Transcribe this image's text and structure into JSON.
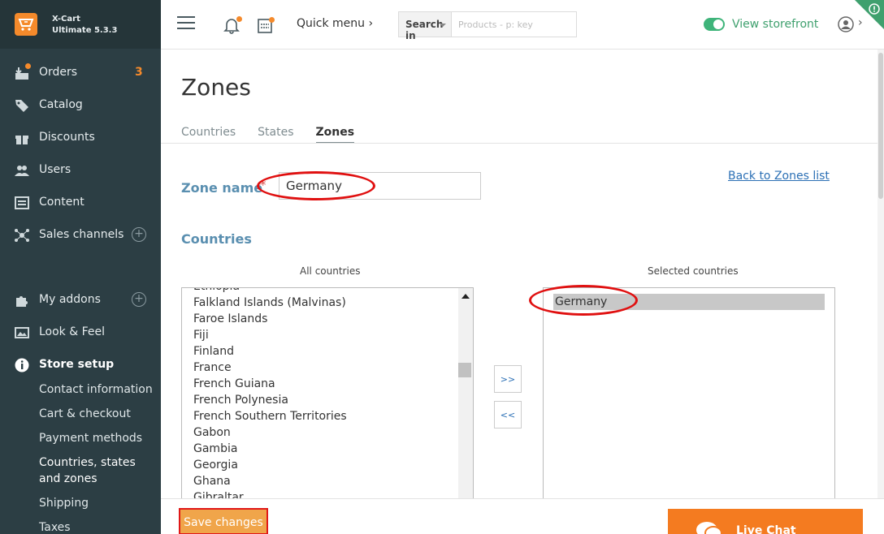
{
  "brand": {
    "name": "X-Cart",
    "edition": "Ultimate 5.3.3"
  },
  "sidebar": {
    "items": [
      {
        "label": "Orders",
        "badge": "3",
        "icon": "orders-icon"
      },
      {
        "label": "Catalog",
        "icon": "tag-icon"
      },
      {
        "label": "Discounts",
        "icon": "gift-icon"
      },
      {
        "label": "Users",
        "icon": "users-icon"
      },
      {
        "label": "Content",
        "icon": "content-icon"
      },
      {
        "label": "Sales channels",
        "icon": "share-icon"
      },
      {
        "label": "My addons",
        "icon": "puzzle-icon"
      },
      {
        "label": "Look & Feel",
        "icon": "image-icon"
      },
      {
        "label": "Store setup",
        "icon": "info-icon"
      }
    ],
    "store_setup_sub": [
      "Contact information",
      "Cart & checkout",
      "Payment methods",
      "Countries, states",
      "and zones",
      "Shipping",
      "Taxes"
    ]
  },
  "topbar": {
    "quick_menu": "Quick menu",
    "search_in": "Search in",
    "search_placeholder": "Products - p: key",
    "view_storefront": "View storefront"
  },
  "page": {
    "title": "Zones",
    "tabs": [
      "Countries",
      "States",
      "Zones"
    ],
    "active_tab": "Zones",
    "zone_name_label": "Zone name",
    "required_mark": "*",
    "zone_name_value": "Germany",
    "back_link": "Back to Zones list",
    "countries_heading": "Countries",
    "all_countries_label": "All countries",
    "selected_countries_label": "Selected countries",
    "all_countries": [
      "Ethiopia",
      "Falkland Islands (Malvinas)",
      "Faroe Islands",
      "Fiji",
      "Finland",
      "France",
      "French Guiana",
      "French Polynesia",
      "French Southern Territories",
      "Gabon",
      "Gambia",
      "Georgia",
      "Ghana",
      "Gibraltar"
    ],
    "selected_countries": [
      "Germany"
    ],
    "add_button": ">>",
    "remove_button": "<<",
    "save_button": "Save changes"
  },
  "live_chat": {
    "label": "Live Chat"
  },
  "colors": {
    "sidebar_bg": "#2c3e44",
    "accent_orange": "#f58a2b",
    "link_blue": "#2c70b5",
    "heading_blue": "#5a8fb0",
    "storefront_green": "#3fb47a",
    "annotation_red": "#e01010"
  }
}
